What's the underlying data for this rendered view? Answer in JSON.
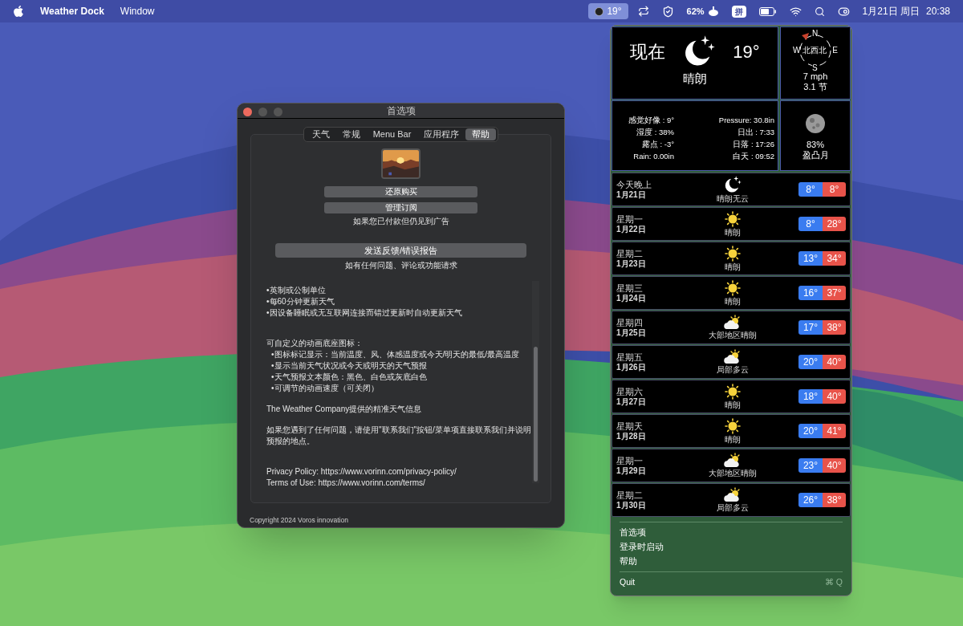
{
  "menu_bar": {
    "app_name": "Weather Dock",
    "menus": [
      "Window"
    ],
    "status_temp": "19°",
    "battery_percent": "62%",
    "input_method": "拼",
    "date": "1月21日 周日",
    "time": "20:38"
  },
  "preferences": {
    "title": "首选项",
    "tabs": [
      {
        "label": "天气",
        "selected": false
      },
      {
        "label": "常规",
        "selected": false
      },
      {
        "label": "Menu Bar",
        "selected": false
      },
      {
        "label": "应用程序",
        "selected": false
      },
      {
        "label": "帮助",
        "selected": true
      }
    ],
    "restore_button": "还原购买",
    "manage_button": "管理订阅",
    "ads_note": "如果您已付款但仍见到广告",
    "feedback_button": "发送反馈/错误报告",
    "feedback_note": "如有任何问题、评论或功能请求",
    "help_groups": [
      [
        {
          "kind": "bullet",
          "text": "•英制或公制单位"
        },
        {
          "kind": "bullet",
          "text": "•每60分钟更新天气"
        },
        {
          "kind": "bullet",
          "text": "•因设备睡眠或无互联网连接而错过更新时自动更新天气"
        }
      ],
      [
        {
          "kind": "text",
          "text": "可自定义的动画底座图标："
        },
        {
          "kind": "sub_bullet",
          "text": "•图标标记显示：当前温度、风、体感温度或今天/明天的最低/最高温度"
        },
        {
          "kind": "sub_bullet",
          "text": "•显示当前天气状况或今天或明天的天气预报"
        },
        {
          "kind": "sub_bullet",
          "text": "•天气预报文本颜色：黑色、白色或灰底白色"
        },
        {
          "kind": "sub_bullet",
          "text": "•可调节的动画速度（可关闭）"
        }
      ],
      [
        {
          "kind": "text",
          "text": "The Weather Company提供的精准天气信息"
        }
      ],
      [
        {
          "kind": "text",
          "text": "如果您遇到了任何问题，请使用\"联系我们\"按钮/菜单项直接联系我们并说明预报的地点。"
        }
      ],
      [
        {
          "kind": "text",
          "text": "Privacy Policy: https://www.vorinn.com/privacy-policy/"
        },
        {
          "kind": "text",
          "text": "Terms of Use: https://www.vorinn.com/terms/"
        }
      ]
    ],
    "copyright": "Copyright 2024 Voros innovation"
  },
  "weather": {
    "current": {
      "label": "现在",
      "temp": "19°",
      "condition": "晴朗"
    },
    "wind": {
      "north": "N",
      "east": "E",
      "south": "S",
      "west": "W",
      "direction": "北西北",
      "speed": "7 mph",
      "knots": "3.1 节"
    },
    "details_left": [
      "感觉好像 : 9°",
      "湿度 : 38%",
      "露点 : -3°",
      "Rain: 0.00in"
    ],
    "details_right": [
      "Pressure: 30.8in",
      "日出 : 7:33",
      "日落 : 17:26",
      "白天 : 09:52"
    ],
    "moon": {
      "illumination": "83%",
      "phase": "盈凸月"
    },
    "forecast": [
      {
        "day": "今天晚上",
        "date": "1月21日",
        "kind": "moon",
        "condition": "晴朗无云",
        "low": "8°",
        "high": "8°"
      },
      {
        "day": "星期一",
        "date": "1月22日",
        "kind": "sun",
        "condition": "晴朗",
        "low": "8°",
        "high": "28°"
      },
      {
        "day": "星期二",
        "date": "1月23日",
        "kind": "sun",
        "condition": "晴朗",
        "low": "13°",
        "high": "34°"
      },
      {
        "day": "星期三",
        "date": "1月24日",
        "kind": "sun",
        "condition": "晴朗",
        "low": "16°",
        "high": "37°"
      },
      {
        "day": "星期四",
        "date": "1月25日",
        "kind": "partly_cloudy",
        "condition": "大部地区晴朗",
        "low": "17°",
        "high": "38°"
      },
      {
        "day": "星期五",
        "date": "1月26日",
        "kind": "partly_cloudy",
        "condition": "局部多云",
        "low": "20°",
        "high": "40°"
      },
      {
        "day": "星期六",
        "date": "1月27日",
        "kind": "sun",
        "condition": "晴朗",
        "low": "18°",
        "high": "40°"
      },
      {
        "day": "星期天",
        "date": "1月28日",
        "kind": "sun",
        "condition": "晴朗",
        "low": "20°",
        "high": "41°"
      },
      {
        "day": "星期一",
        "date": "1月29日",
        "kind": "partly_cloudy",
        "condition": "大部地区晴朗",
        "low": "23°",
        "high": "40°"
      },
      {
        "day": "星期二",
        "date": "1月30日",
        "kind": "partly_cloudy",
        "condition": "局部多云",
        "low": "26°",
        "high": "38°"
      }
    ],
    "menu": [
      "首选项",
      "登录时启动",
      "帮助"
    ],
    "quit": {
      "label": "Quit",
      "shortcut": "⌘ Q"
    }
  }
}
